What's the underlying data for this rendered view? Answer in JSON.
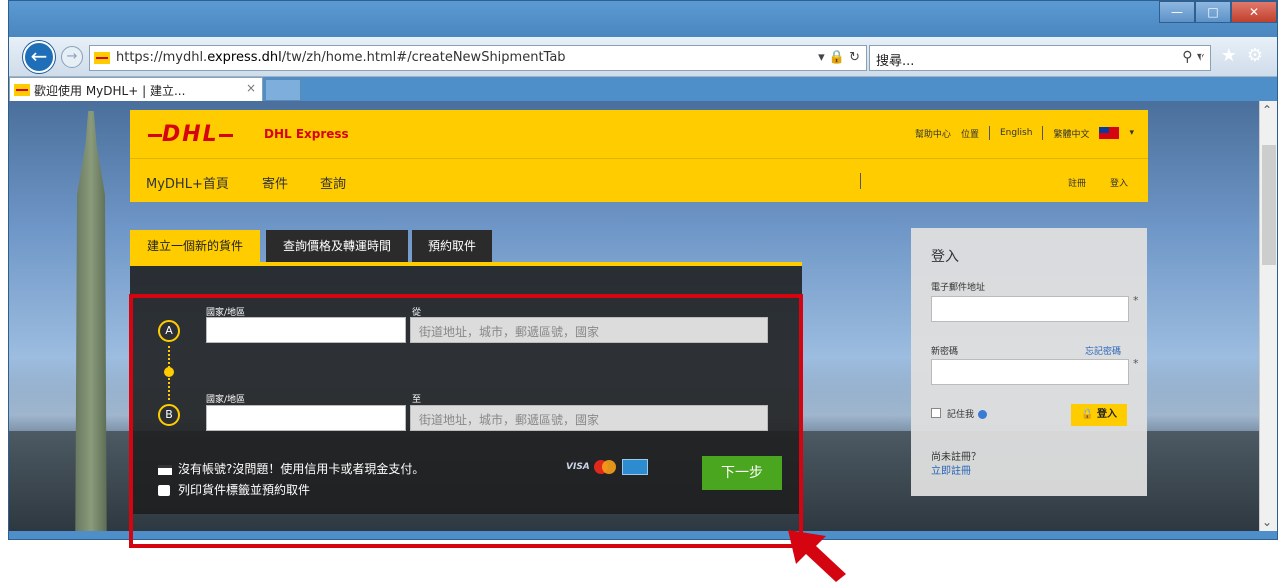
{
  "browser": {
    "url_prefix": "https://mydhl.",
    "url_host": "express.dhl",
    "url_path": "/tw/zh/home.html#/createNewShipmentTab",
    "search_placeholder": "搜尋...",
    "tab_title": "歡迎使用 MyDHL+ | 建立...",
    "tab_close": "×"
  },
  "header": {
    "logo": "DHL",
    "brand_label": "DHL Express",
    "help_center": "幫助中心",
    "location": "位置",
    "lang_english": "English",
    "lang_chinese": "繁體中文"
  },
  "nav": {
    "home": "MyDHL+首頁",
    "ship": "寄件",
    "track": "查詢",
    "register": "註冊",
    "login": "登入"
  },
  "tabs": {
    "create": "建立一個新的貨件",
    "quote": "查詢價格及轉運時間",
    "pickup": "預約取件"
  },
  "form": {
    "from_marker": "A",
    "to_marker": "B",
    "country_label": "國家/地區",
    "from_label": "從",
    "to_label": "至",
    "address_placeholder": "街道地址，城市，郵遞區號，國家",
    "pay_text": "沒有帳號?沒問題！使用信用卡或者現金支付。",
    "print_text": "列印貨件標籤並預約取件",
    "card_visa": "VISA",
    "next_button": "下一步"
  },
  "login": {
    "title": "登入",
    "email_label": "電子郵件地址",
    "password_label": "新密碼",
    "forgot": "忘記密碼",
    "remember": "記住我",
    "button": "登入",
    "no_account": "尚未註冊？",
    "register_now": "立即註冊",
    "required_mark": "*"
  },
  "colors": {
    "dhl_yellow": "#ffcc00",
    "dhl_red": "#d40511",
    "next_green": "#4aa61f",
    "annotation_red": "#d40511"
  }
}
